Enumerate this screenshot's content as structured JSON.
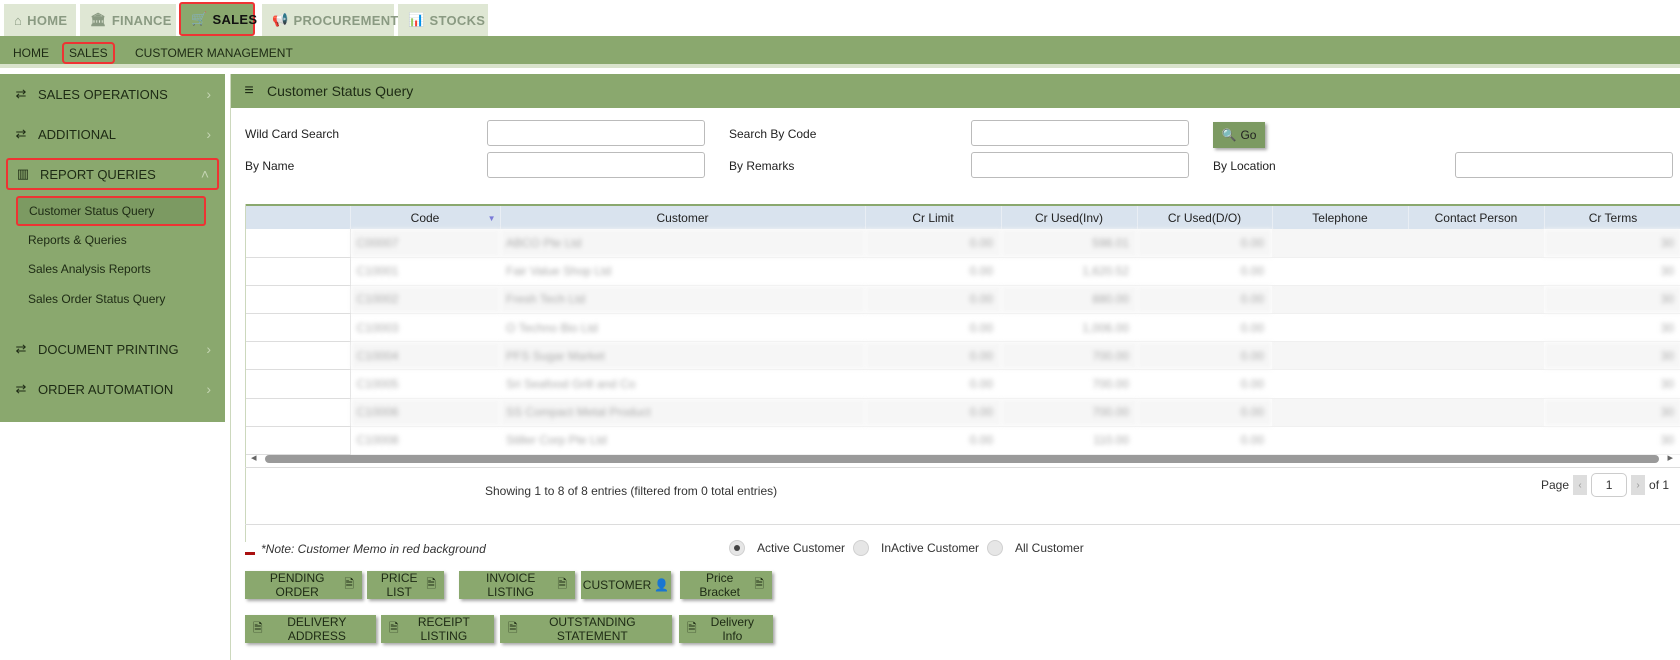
{
  "top_tabs": [
    {
      "label": "HOME",
      "icon": "home-icon"
    },
    {
      "label": "FINANCE",
      "icon": "bank-icon"
    },
    {
      "label": "SALES",
      "icon": "cart-icon"
    },
    {
      "label": "PROCUREMENT",
      "icon": "megaphone-icon"
    },
    {
      "label": "STOCKS",
      "icon": "bar-chart-icon"
    }
  ],
  "sub_nav": [
    "HOME",
    "SALES",
    "CUSTOMER MANAGEMENT"
  ],
  "sidebar": {
    "items": [
      {
        "label": "SALES OPERATIONS",
        "icon": "exchange-icon"
      },
      {
        "label": "ADDITIONAL",
        "icon": "exchange-icon"
      },
      {
        "label": "REPORT QUERIES",
        "icon": "bar-chart-icon"
      },
      {
        "label": "DOCUMENT PRINTING",
        "icon": "exchange-icon"
      },
      {
        "label": "ORDER AUTOMATION",
        "icon": "exchange-icon"
      }
    ],
    "report_sub": [
      "Customer Status Query",
      "Reports & Queries",
      "Sales Analysis Reports",
      "Sales Order Status Query"
    ]
  },
  "panel": {
    "title": "Customer Status Query"
  },
  "filters": {
    "wild_card": "Wild Card Search",
    "by_code": "Search By Code",
    "by_name": "By Name",
    "by_remarks": "By Remarks",
    "by_location": "By Location",
    "go": "Go"
  },
  "table": {
    "headers": [
      "",
      "Code",
      "Customer",
      "Cr Limit",
      "Cr Used(Inv)",
      "Cr Used(D/O)",
      "Telephone",
      "Contact Person",
      "Cr Terms"
    ],
    "rows": [
      [
        "C00007",
        "ABCO Pte Ltd",
        "0.00",
        "598.01",
        "0.00",
        "30"
      ],
      [
        "C10001",
        "Fair Value Shop Ltd",
        "0.00",
        "1,620.52",
        "0.00",
        "30"
      ],
      [
        "C10002",
        "Fresh Tech Ltd",
        "0.00",
        "880.00",
        "0.00",
        "30"
      ],
      [
        "C10003",
        "O Techno Bio Ltd",
        "0.00",
        "1,006.00",
        "0.00",
        "30"
      ],
      [
        "C10004",
        "PFS Sugar Market",
        "0.00",
        "700.00",
        "0.00",
        "30"
      ],
      [
        "C10005",
        "Sri Seafood Grill and Co",
        "0.00",
        "700.00",
        "0.00",
        "30"
      ],
      [
        "C10006",
        "SS Compact Metal Product",
        "0.00",
        "700.00",
        "0.00",
        "30"
      ],
      [
        "C10008",
        "Stiller Corp Pte Ltd",
        "0.00",
        "110.00",
        "0.00",
        "30"
      ]
    ]
  },
  "info_text": "Showing 1 to 8 of 8 entries (filtered from 0 total entries)",
  "pager": {
    "page_label": "Page",
    "page": "1",
    "of_label": "of 1"
  },
  "note": "*Note: Customer Memo in red background",
  "radios": [
    {
      "label": "Active Customer",
      "selected": true
    },
    {
      "label": "InActive Customer",
      "selected": false
    },
    {
      "label": "All Customer",
      "selected": false
    }
  ],
  "buttons_row1": [
    "PENDING ORDER",
    "PRICE LIST",
    "INVOICE LISTING",
    "CUSTOMER",
    "Price Bracket"
  ],
  "buttons_row2": [
    "DELIVERY ADDRESS",
    "RECEIPT LISTING",
    "OUTSTANDING STATEMENT",
    "Delivery Info"
  ],
  "colors": {
    "accent": "#8aa86e",
    "highlight_border": "#ee3333",
    "table_header": "#d9e3ee"
  }
}
